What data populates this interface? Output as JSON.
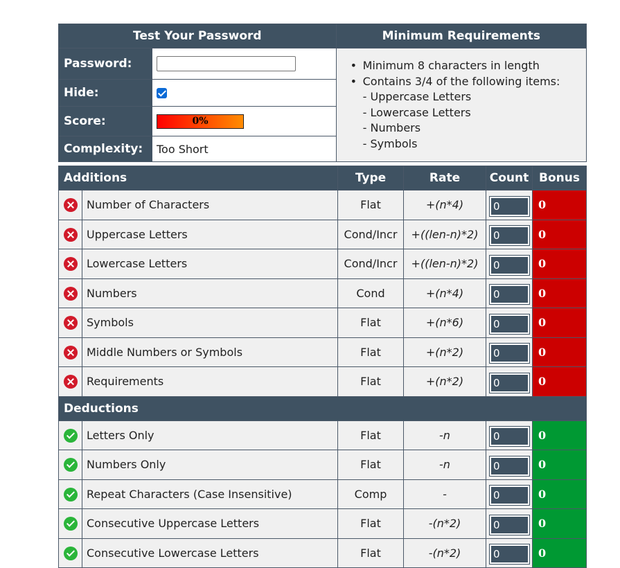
{
  "top": {
    "test_header": "Test Your Password",
    "req_header": "Minimum Requirements",
    "password_label": "Password:",
    "password_value": "",
    "hide_label": "Hide:",
    "hide_checked": true,
    "score_label": "Score:",
    "score_value": "0%",
    "complexity_label": "Complexity:",
    "complexity_value": "Too Short",
    "requirements": [
      "Minimum 8 characters in length",
      "Contains 3/4 of the following items:"
    ],
    "sub_requirements": [
      "- Uppercase Letters",
      "- Lowercase Letters",
      "- Numbers",
      "- Symbols"
    ]
  },
  "columns": {
    "additions": "Additions",
    "type": "Type",
    "rate": "Rate",
    "count": "Count",
    "bonus": "Bonus",
    "deductions": "Deductions"
  },
  "colors": {
    "header_bg": "#3f5262",
    "bonus_red": "#cc0000",
    "bonus_green": "#009933"
  },
  "additions": [
    {
      "icon": "fail-icon",
      "name": "Number of Characters",
      "type": "Flat",
      "rate": "+(n*4)",
      "count": "0",
      "bonus": "0"
    },
    {
      "icon": "fail-icon",
      "name": "Uppercase Letters",
      "type": "Cond/Incr",
      "rate": "+((len-n)*2)",
      "count": "0",
      "bonus": "0"
    },
    {
      "icon": "fail-icon",
      "name": "Lowercase Letters",
      "type": "Cond/Incr",
      "rate": "+((len-n)*2)",
      "count": "0",
      "bonus": "0"
    },
    {
      "icon": "fail-icon",
      "name": "Numbers",
      "type": "Cond",
      "rate": "+(n*4)",
      "count": "0",
      "bonus": "0"
    },
    {
      "icon": "fail-icon",
      "name": "Symbols",
      "type": "Flat",
      "rate": "+(n*6)",
      "count": "0",
      "bonus": "0"
    },
    {
      "icon": "fail-icon",
      "name": "Middle Numbers or Symbols",
      "type": "Flat",
      "rate": "+(n*2)",
      "count": "0",
      "bonus": "0"
    },
    {
      "icon": "fail-icon",
      "name": "Requirements",
      "type": "Flat",
      "rate": "+(n*2)",
      "count": "0",
      "bonus": "0"
    }
  ],
  "deductions": [
    {
      "icon": "pass-icon",
      "name": "Letters Only",
      "type": "Flat",
      "rate": "-n",
      "count": "0",
      "bonus": "0"
    },
    {
      "icon": "pass-icon",
      "name": "Numbers Only",
      "type": "Flat",
      "rate": "-n",
      "count": "0",
      "bonus": "0"
    },
    {
      "icon": "pass-icon",
      "name": "Repeat Characters (Case Insensitive)",
      "type": "Comp",
      "rate": "-",
      "count": "0",
      "bonus": "0"
    },
    {
      "icon": "pass-icon",
      "name": "Consecutive Uppercase Letters",
      "type": "Flat",
      "rate": "-(n*2)",
      "count": "0",
      "bonus": "0"
    },
    {
      "icon": "pass-icon",
      "name": "Consecutive Lowercase Letters",
      "type": "Flat",
      "rate": "-(n*2)",
      "count": "0",
      "bonus": "0"
    }
  ]
}
